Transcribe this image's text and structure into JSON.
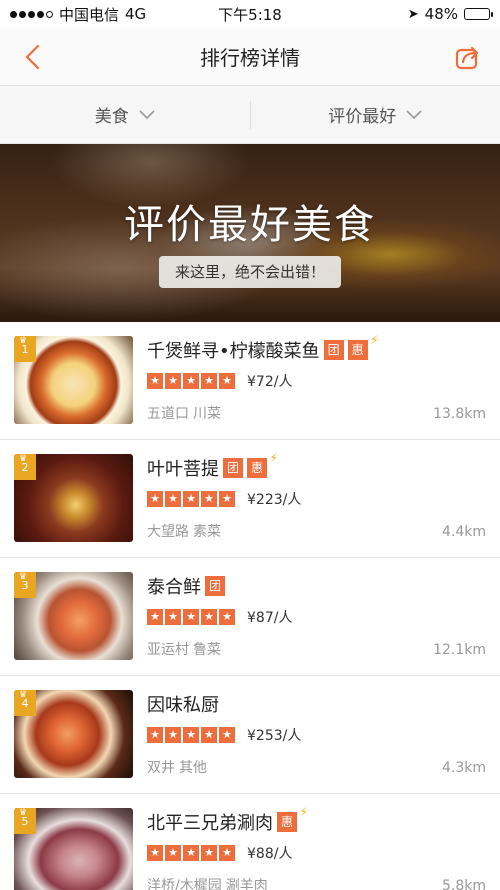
{
  "status_bar": {
    "carrier": "中国电信",
    "network": "4G",
    "time": "下午5:18",
    "battery": "48%",
    "battery_level": 0.48
  },
  "nav": {
    "title": "排行榜详情"
  },
  "filters": [
    {
      "label": "美食"
    },
    {
      "label": "评价最好"
    }
  ],
  "banner": {
    "title": "评价最好美食",
    "subtitle": "来这里，绝不会出错！"
  },
  "colors": {
    "accent": "#ee6d3c",
    "rank_badge": "#e9a623"
  },
  "restaurants": [
    {
      "rank": "1",
      "name": "千煲鲜寻•柠檬酸菜鱼",
      "tags": [
        "团",
        "惠"
      ],
      "rating": 5,
      "price": "¥72/人",
      "area": "五道口",
      "cuisine": "川菜",
      "distance": "13.8km"
    },
    {
      "rank": "2",
      "name": "叶叶菩提",
      "tags": [
        "团",
        "惠"
      ],
      "rating": 5,
      "price": "¥223/人",
      "area": "大望路",
      "cuisine": "素菜",
      "distance": "4.4km"
    },
    {
      "rank": "3",
      "name": "泰合鲜",
      "tags": [
        "团"
      ],
      "rating": 5,
      "price": "¥87/人",
      "area": "亚运村",
      "cuisine": "鲁菜",
      "distance": "12.1km"
    },
    {
      "rank": "4",
      "name": "因味私厨",
      "tags": [],
      "rating": 5,
      "price": "¥253/人",
      "area": "双井",
      "cuisine": "其他",
      "distance": "4.3km"
    },
    {
      "rank": "5",
      "name": "北平三兄弟涮肉",
      "tags": [
        "惠"
      ],
      "rating": 5,
      "price": "¥88/人",
      "area": "洋桥/木樨园",
      "cuisine": "涮羊肉",
      "distance": "5.8km"
    }
  ]
}
